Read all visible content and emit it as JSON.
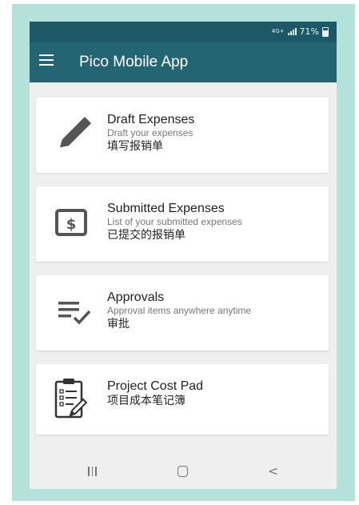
{
  "status_bar": {
    "network": "4G+",
    "battery": "71%",
    "battery_level": 0.71
  },
  "app_bar": {
    "title": "Pico Mobile App",
    "menu_icon": "hamburger-menu-icon"
  },
  "cards": [
    {
      "title": "Draft Expenses",
      "subtitle": "Draft your expenses",
      "chinese": "填写报销单",
      "icon": "pencil-icon"
    },
    {
      "title": "Submitted Expenses",
      "subtitle": "List of your submitted expenses",
      "chinese": "已提交的报销单",
      "icon": "dollar-bill-icon"
    },
    {
      "title": "Approvals",
      "subtitle": "Approval items anywhere anytime",
      "chinese": "审批",
      "icon": "checklist-icon"
    },
    {
      "title": "Project Cost Pad",
      "chinese": "项目成本笔记簿",
      "icon": "clipboard-icon"
    }
  ],
  "nav_bar": {
    "recent_icon": "recent-apps-icon",
    "home_icon": "home-icon",
    "back_icon": "back-icon",
    "back_glyph": "<"
  },
  "colors": {
    "status_bar": "#1d5866",
    "app_bar": "#236573",
    "frame": "#b4e1da",
    "background": "#efefef",
    "card": "#ffffff"
  }
}
